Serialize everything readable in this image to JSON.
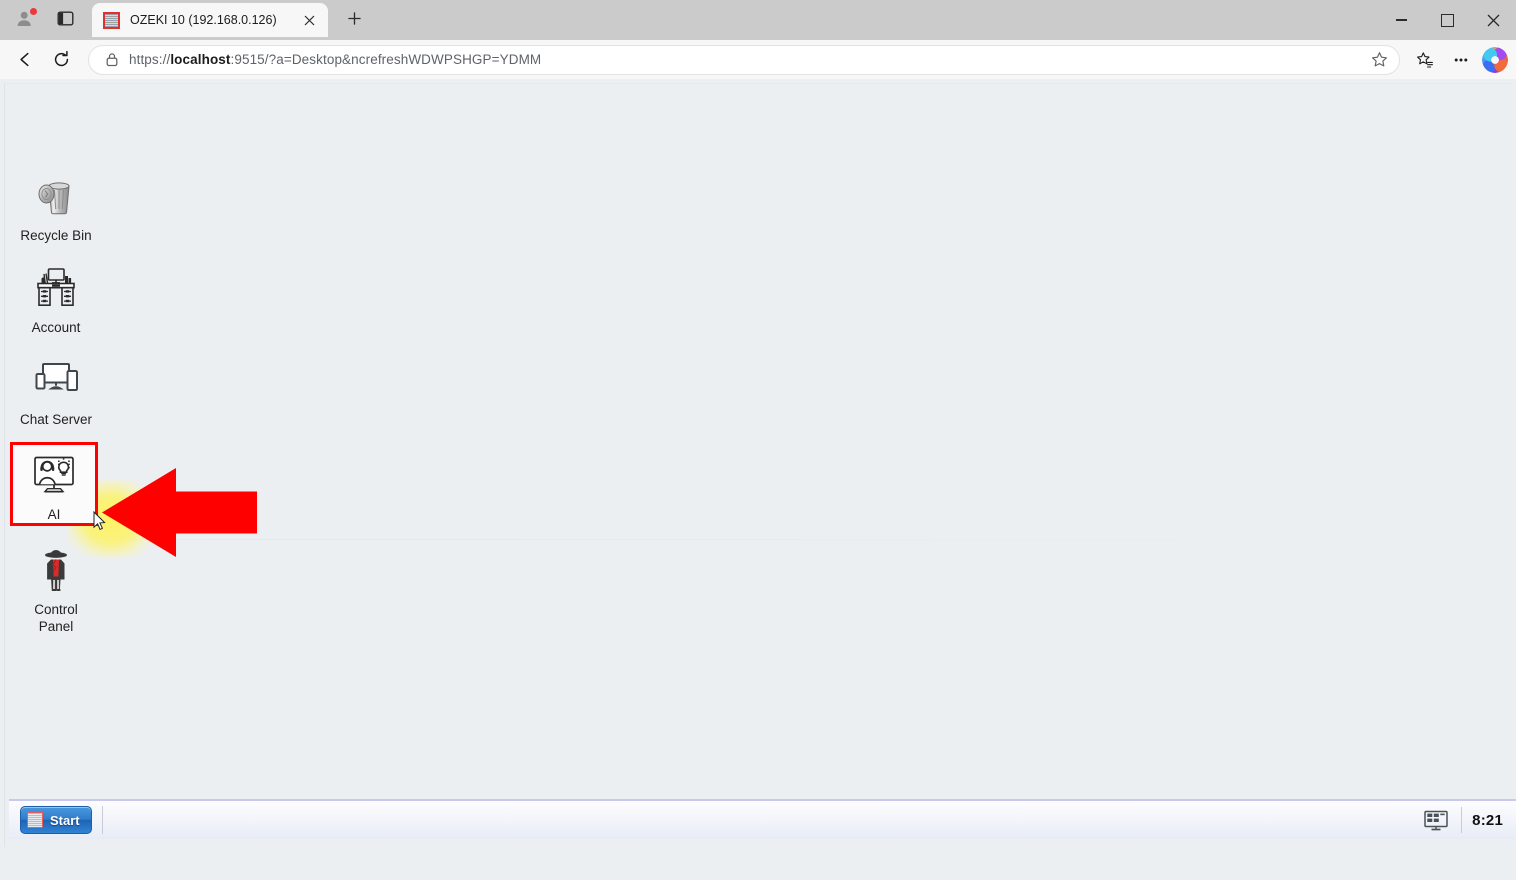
{
  "browser": {
    "profile_icon": "account-avatar-icon",
    "profile_badge": "notification-dot",
    "tab_search_icon": "tab-search-icon",
    "tab": {
      "favicon": "ozeki-grid-favicon",
      "title": "OZEKI 10 (192.168.0.126)",
      "close_icon": "close-icon"
    },
    "new_tab_label": "+",
    "window_controls": {
      "minimize": "minimize-icon",
      "maximize": "maximize-icon",
      "close": "close-icon"
    },
    "toolbar": {
      "back_icon": "back-arrow-icon",
      "reload_icon": "reload-icon",
      "lock_icon": "lock-icon",
      "url_prefix": "https://",
      "url_host": "localhost",
      "url_rest": ":9515/?a=Desktop&ncrefreshWDWPSHGP=YDMM",
      "url_full": "https://localhost:9515/?a=Desktop&ncrefreshWDWPSHGP=YDMM",
      "favorite_icon": "star-icon",
      "collections_icon": "collections-icon",
      "settings_icon": "ellipsis-icon",
      "copilot_icon": "copilot-icon"
    }
  },
  "desktop": {
    "background_color": "#eceff1",
    "icons": [
      {
        "name": "recycle-bin",
        "label": "Recycle Bin",
        "selected": false
      },
      {
        "name": "account",
        "label": "Account",
        "selected": false
      },
      {
        "name": "chat-server",
        "label": "Chat Server",
        "selected": false
      },
      {
        "name": "ai",
        "label": "AI",
        "selected": true
      },
      {
        "name": "control-panel",
        "label": "Control\nPanel",
        "selected": false
      }
    ],
    "annotation": {
      "arrow_color": "#ff0000",
      "arrow_direction": "left",
      "highlight_color": "#fff35a",
      "selection_border_color": "#ff0000",
      "target": "AI"
    }
  },
  "taskbar": {
    "start_label": "Start",
    "start_icon": "ozeki-grid-icon",
    "tray_icon": "show-desktop-icon",
    "clock": "8:21"
  }
}
